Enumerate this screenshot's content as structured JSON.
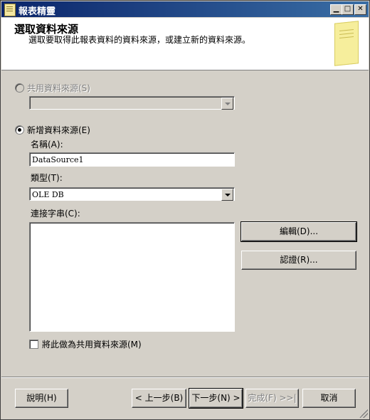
{
  "window": {
    "title": "報表精靈",
    "minimize_glyph": "▁",
    "maximize_glyph": "□",
    "close_glyph": "✕"
  },
  "header": {
    "title": "選取資料來源",
    "subtitle": "選取要取得此報表資料的資料來源，或建立新的資料來源。",
    "image_icon": "report-page-icon"
  },
  "shared_source": {
    "label": "共用資料來源(S)",
    "selected": false,
    "enabled": false,
    "value": ""
  },
  "new_source": {
    "label": "新增資料來源(E)",
    "selected": true,
    "name_label": "名稱(A):",
    "name_value": "DataSource1",
    "type_label": "類型(T):",
    "type_value": "OLE DB",
    "conn_label": "連接字串(C):",
    "conn_value": "",
    "edit_button": "編輯(D)...",
    "cred_button": "認證(R)...",
    "make_shared_label": "將此做為共用資料來源(M)",
    "make_shared_checked": false
  },
  "footer": {
    "help": "說明(H)",
    "back": "< 上一步(B)",
    "next": "下一步(N) >",
    "finish": "完成(F) >>|",
    "cancel": "取消"
  }
}
